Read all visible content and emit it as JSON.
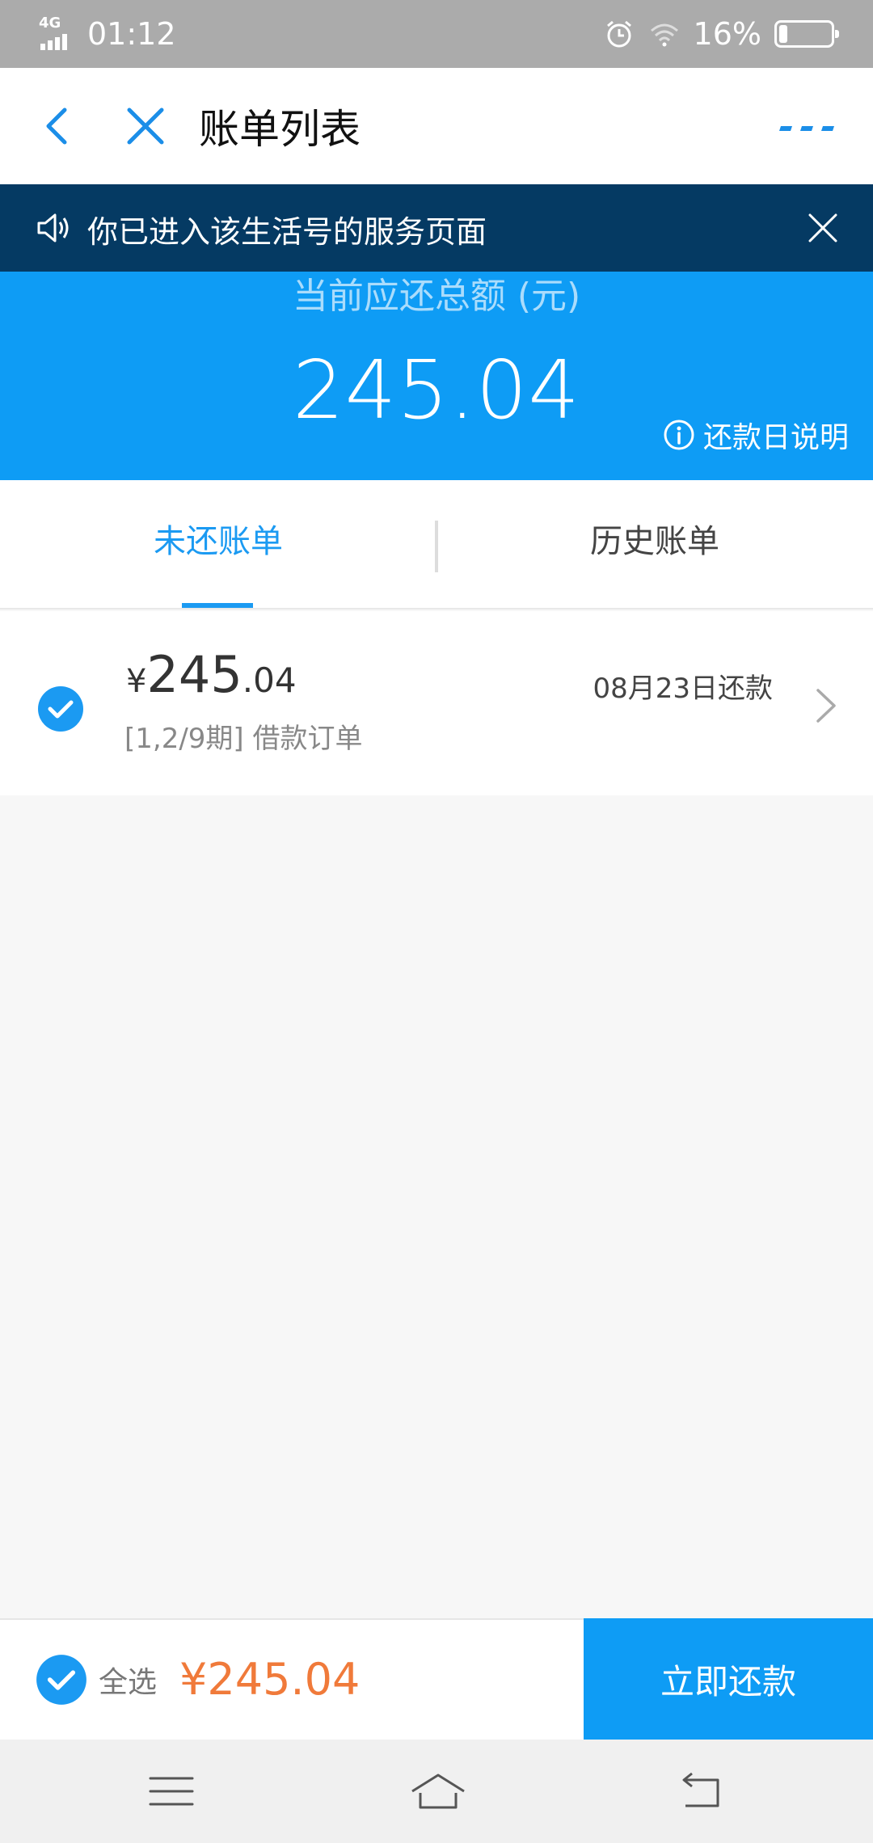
{
  "status_bar": {
    "network": "4G",
    "time": "01:12",
    "battery_percent_text": "16%",
    "battery_level": 0.16
  },
  "header": {
    "title": "账单列表"
  },
  "notice": {
    "text": "你已进入该生活号的服务页面"
  },
  "summary": {
    "label": "当前应还总额 (元)",
    "amount": "245.04",
    "repay_info": "还款日说明"
  },
  "tabs": [
    {
      "label": "未还账单",
      "active": true
    },
    {
      "label": "历史账单",
      "active": false
    }
  ],
  "bills": [
    {
      "currency": "¥",
      "amount_int": "245",
      "amount_dec": ".04",
      "desc": "[1,2/9期] 借款订单",
      "due": "08月23日还款",
      "checked": true
    }
  ],
  "footer": {
    "select_all_label": "全选",
    "total": "¥245.04",
    "pay_button": "立即还款"
  },
  "colors": {
    "accent": "#0e9cf5",
    "notice_bg": "#053a63",
    "amount_orange": "#f07a3a"
  }
}
